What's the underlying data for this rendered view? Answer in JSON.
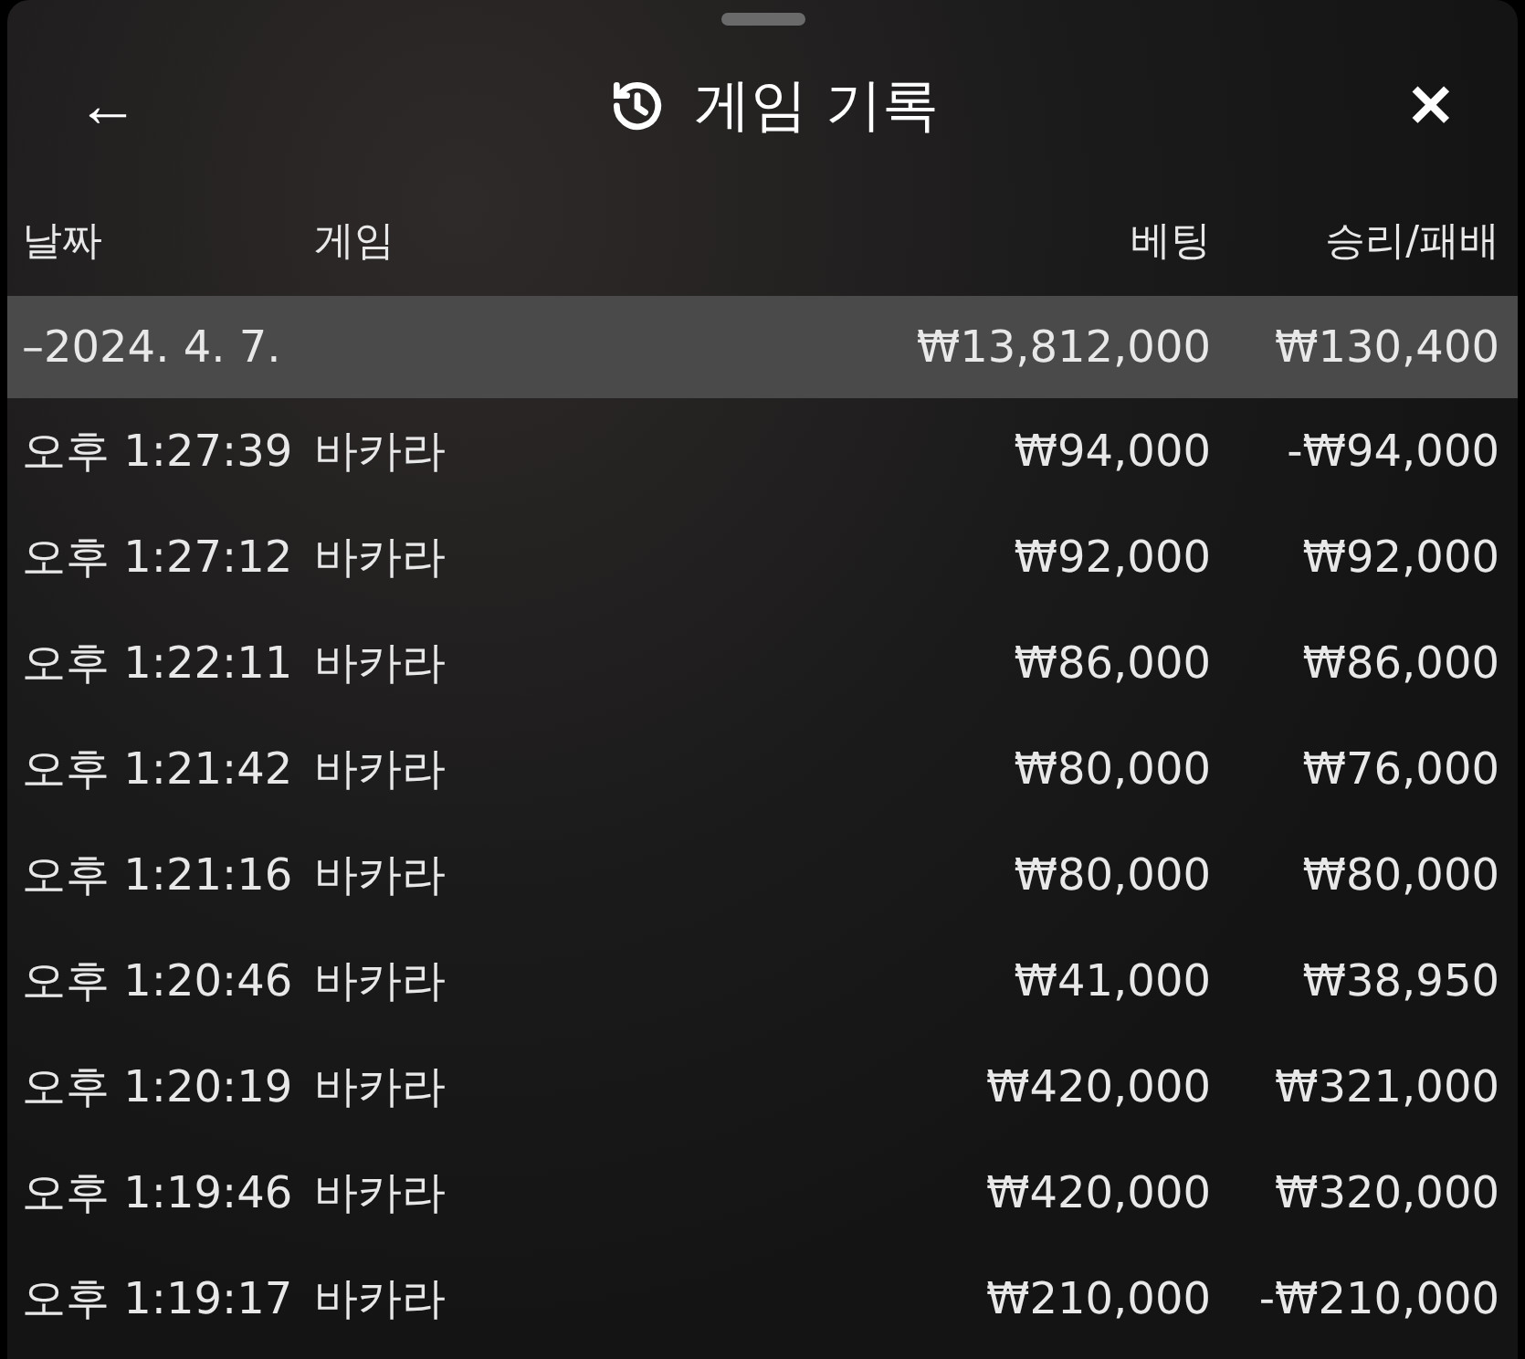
{
  "header": {
    "back": "←",
    "title": "게임 기록",
    "close": "✕"
  },
  "columns": [
    "날짜",
    "게임",
    "베팅",
    "승리/패배"
  ],
  "group": {
    "date": "–2024. 4. 7.",
    "bet": "₩13,812,000",
    "result": "₩130,400"
  },
  "rows": [
    {
      "time": "오후 1:27:39",
      "game": "바카라",
      "bet": "₩94,000",
      "result": "-₩94,000"
    },
    {
      "time": "오후 1:27:12",
      "game": "바카라",
      "bet": "₩92,000",
      "result": "₩92,000"
    },
    {
      "time": "오후 1:22:11",
      "game": "바카라",
      "bet": "₩86,000",
      "result": "₩86,000"
    },
    {
      "time": "오후 1:21:42",
      "game": "바카라",
      "bet": "₩80,000",
      "result": "₩76,000"
    },
    {
      "time": "오후 1:21:16",
      "game": "바카라",
      "bet": "₩80,000",
      "result": "₩80,000"
    },
    {
      "time": "오후 1:20:46",
      "game": "바카라",
      "bet": "₩41,000",
      "result": "₩38,950"
    },
    {
      "time": "오후 1:20:19",
      "game": "바카라",
      "bet": "₩420,000",
      "result": "₩321,000"
    },
    {
      "time": "오후 1:19:46",
      "game": "바카라",
      "bet": "₩420,000",
      "result": "₩320,000"
    },
    {
      "time": "오후 1:19:17",
      "game": "바카라",
      "bet": "₩210,000",
      "result": "-₩210,000"
    }
  ]
}
